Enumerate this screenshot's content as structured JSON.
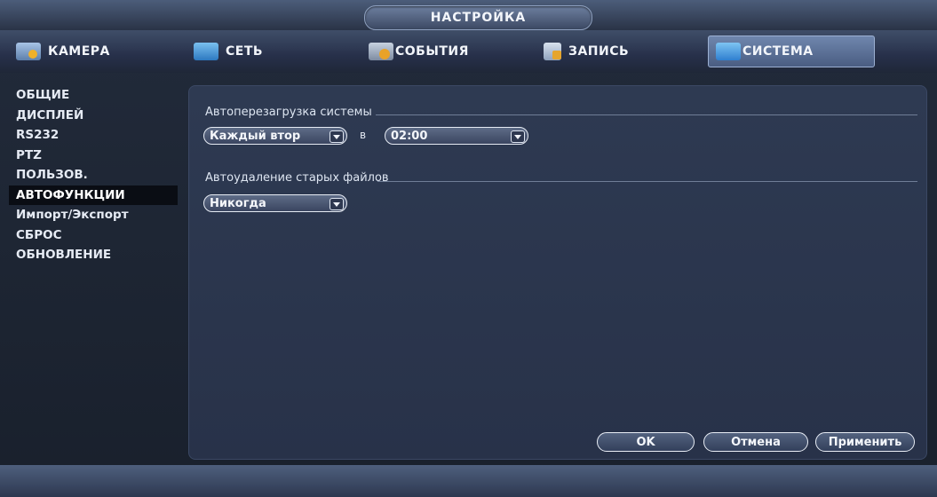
{
  "title": "НАСТРОЙКА",
  "tabs": [
    {
      "label": "КАМЕРА",
      "icon": "camera-icon"
    },
    {
      "label": "СЕТЬ",
      "icon": "network-icon"
    },
    {
      "label": "СОБЫТИЯ",
      "icon": "events-icon"
    },
    {
      "label": "ЗАПИСЬ",
      "icon": "record-icon"
    },
    {
      "label": "СИСТЕМА",
      "icon": "system-icon"
    }
  ],
  "sidebar": {
    "items": [
      {
        "label": "ОБЩИЕ"
      },
      {
        "label": "ДИСПЛЕЙ"
      },
      {
        "label": "RS232"
      },
      {
        "label": "PTZ"
      },
      {
        "label": "ПОЛЬЗОВ."
      },
      {
        "label": "АВТОФУНКЦИИ"
      },
      {
        "label": "Импорт/Экспорт"
      },
      {
        "label": "СБРОС"
      },
      {
        "label": "ОБНОВЛЕНИЕ"
      }
    ]
  },
  "autoreboot": {
    "title": "Автоперезагрузка системы",
    "day_value": "Каждый втор",
    "at_label": "в",
    "time_value": "02:00"
  },
  "autodelete": {
    "title": "Автоудаление старых файлов",
    "value": "Никогда"
  },
  "buttons": {
    "ok": "OK",
    "cancel": "Отмена",
    "apply": "Применить"
  },
  "colors": {
    "background": "#1b2230",
    "active_tab": "#5b7099",
    "panel": "#2b3650"
  }
}
